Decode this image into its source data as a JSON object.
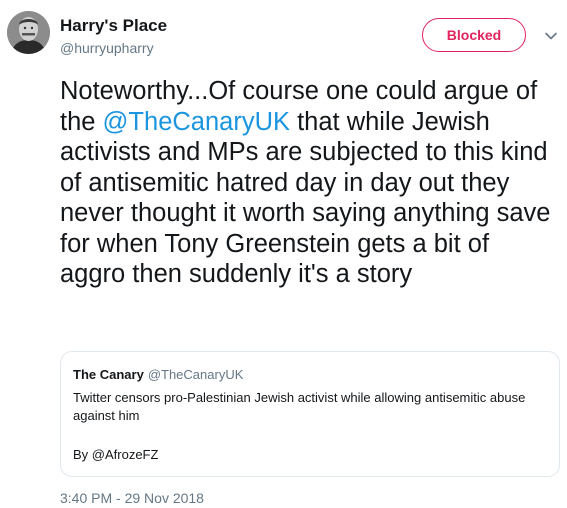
{
  "author": {
    "name": "Harry's Place",
    "handle": "@hurryupharry",
    "avatar_icon": "avatar-portrait"
  },
  "follow_state": {
    "label": "Blocked",
    "color": "#e0245e"
  },
  "menu_icon": "chevron-down-icon",
  "tweet": {
    "text_before": "Noteworthy...Of course one could argue of the ",
    "mention": "@TheCanaryUK",
    "text_after": " that while Jewish activists and MPs are subjected to this kind of antisemitic hatred day in day out they never thought it worth saying anything save for when Tony Greenstein gets a bit of aggro then suddenly it's a story",
    "timestamp": "3:40 PM - 29 Nov 2018"
  },
  "quoted_tweet": {
    "name": "The Canary",
    "handle": "@TheCanaryUK",
    "text": "Twitter censors pro-Palestinian Jewish activist while allowing antisemitic abuse against him",
    "byline": "By @AfrozeFZ"
  },
  "colors": {
    "link": "#1b95e0",
    "secondary": "#657786",
    "border": "#e1e8ed"
  }
}
